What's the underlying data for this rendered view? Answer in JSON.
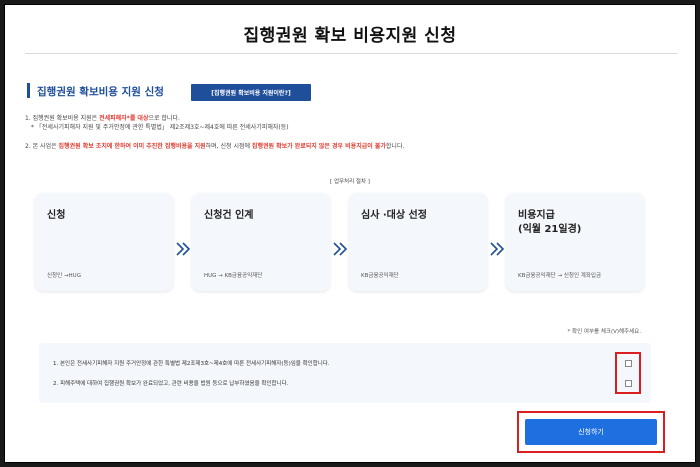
{
  "page": {
    "title": "집행권원 확보 비용지원 신청"
  },
  "section": {
    "title": "집행권원 확보비용 지원 신청",
    "info_button": "[집행권원 확보비용 지원이란?]"
  },
  "notes": {
    "n1_prefix": "1. 집행권원 확보비용 지원은 ",
    "n1_red": "전세피해자*를 대상",
    "n1_suffix": "으로 합니다.",
    "n1_sub": "* 「전세사기피해자 지원 및 주거안정에 관한 특별법」 제2조제3호~제4호에 따른 전세사기피해자(등)",
    "n2_prefix": "2. 본 사업은 ",
    "n2_red1": "집행권원 확보 조치에 한하여 이미 추진한 집행비용을 지원",
    "n2_mid": "하며, 신청 시점에 ",
    "n2_red2": "집행권원 확보가 완료되지 않은 경우 비용지급이 불가",
    "n2_suffix": "합니다."
  },
  "process": {
    "label": "[ 업무처리 절차 ]",
    "steps": [
      {
        "title": "신청",
        "sub": "신청인 →HUG"
      },
      {
        "title": "신청건 인계",
        "sub": "HUG → KB금융공익재단"
      },
      {
        "title": "심사 ·대상 선정",
        "sub": "KB금융공익재단"
      },
      {
        "title": "비용지급\n(익월 21일경)",
        "sub": "KB금융공익재단 → 신청인 계좌입금"
      }
    ]
  },
  "confirm": {
    "note": "* 확인 여부를 체크(V)해주세요.",
    "items": [
      {
        "text": "1. 본인은 전세사기피해자 지원 주거안정에 관한 특별법 제2조제3호~제4호에 따른 전세사기피해자(등)임을 확인합니다.",
        "checked": false
      },
      {
        "text": "2. 피해주택에 대하여 집행권원 확보가 완료되었고, 관련 비용을 법원 등으로 납부하였음을 확인합니다.",
        "checked": false
      }
    ]
  },
  "actions": {
    "submit_label": "신청하기"
  },
  "colors": {
    "primary": "#1f4e9b",
    "accent": "#1e6fe0",
    "warning": "#e03c31",
    "highlight": "#d91f1f"
  }
}
